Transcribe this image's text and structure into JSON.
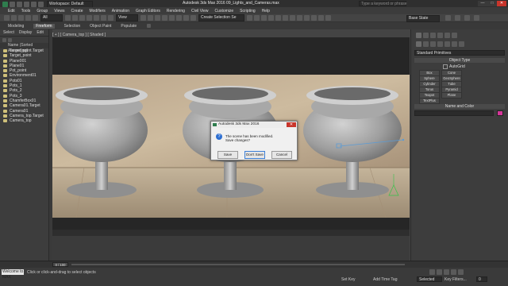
{
  "window": {
    "workspace": "Workspace: Default",
    "title": "Autodesk 3ds Max 2016    09_Lights_and_Cameras.max",
    "search_placeholder": "Type a keyword or phrase",
    "minimize": "—",
    "maximize": "□",
    "close": "✕"
  },
  "menu": [
    "Edit",
    "Tools",
    "Group",
    "Views",
    "Create",
    "Modifiers",
    "Animation",
    "Graph Editors",
    "Rendering",
    "Civil View",
    "Customize",
    "Scripting",
    "Help"
  ],
  "toolbar": {
    "selection_filter": "All",
    "view_dropdown": "View",
    "named_selection": "Create Selection Se",
    "state_sets": "Base State"
  },
  "ribbon": {
    "tabs": [
      "Modeling",
      "Freeform",
      "Selection",
      "Object Paint",
      "Populate"
    ]
  },
  "explorer": {
    "tabs": [
      "Select",
      "Display",
      "Edit"
    ],
    "header": "Name (Sorted Ascending)",
    "items": [
      "Target_point.Target",
      "Target_point",
      "Plane001",
      "Plane01",
      "Pot_point",
      "Environment01",
      "Pots01",
      "Pots_1",
      "Pots_2",
      "Pots_3",
      "ChamferBox01",
      "Camera01.Target",
      "Camera01",
      "Camera_top.Target",
      "Camera_top"
    ]
  },
  "viewport": {
    "label": "[ + ] [ Camera_top ] [ Shaded ]",
    "frame_counter": "0 / 100"
  },
  "command_panel": {
    "dropdown": "Standard Primitives",
    "object_type_title": "Object Type",
    "autogrid": "AutoGrid",
    "buttons": [
      "Box",
      "Cone",
      "Sphere",
      "GeoSphere",
      "Cylinder",
      "Tube",
      "Torus",
      "Pyramid",
      "Teapot",
      "Plane",
      "TextPlus"
    ],
    "name_color_title": "Name and Color"
  },
  "dialog": {
    "title": "Autodesk 3ds Max 2016",
    "line1": "The scene has been modified.",
    "line2": "Save changes?",
    "buttons": [
      "Save",
      "Don't Save",
      "Cancel"
    ]
  },
  "status": {
    "welcome": "Welcome to MAX",
    "hint": "Click or click-and-drag to select objects",
    "selected_label": "Selected",
    "set_key": "Set Key",
    "add_time_tag": "Add Time Tag",
    "key_filters": "Key Filters...",
    "frame": "0"
  },
  "colors": {
    "accent": "#5b9bd5",
    "close_red": "#c8352b",
    "swatch": "#d6359a"
  }
}
